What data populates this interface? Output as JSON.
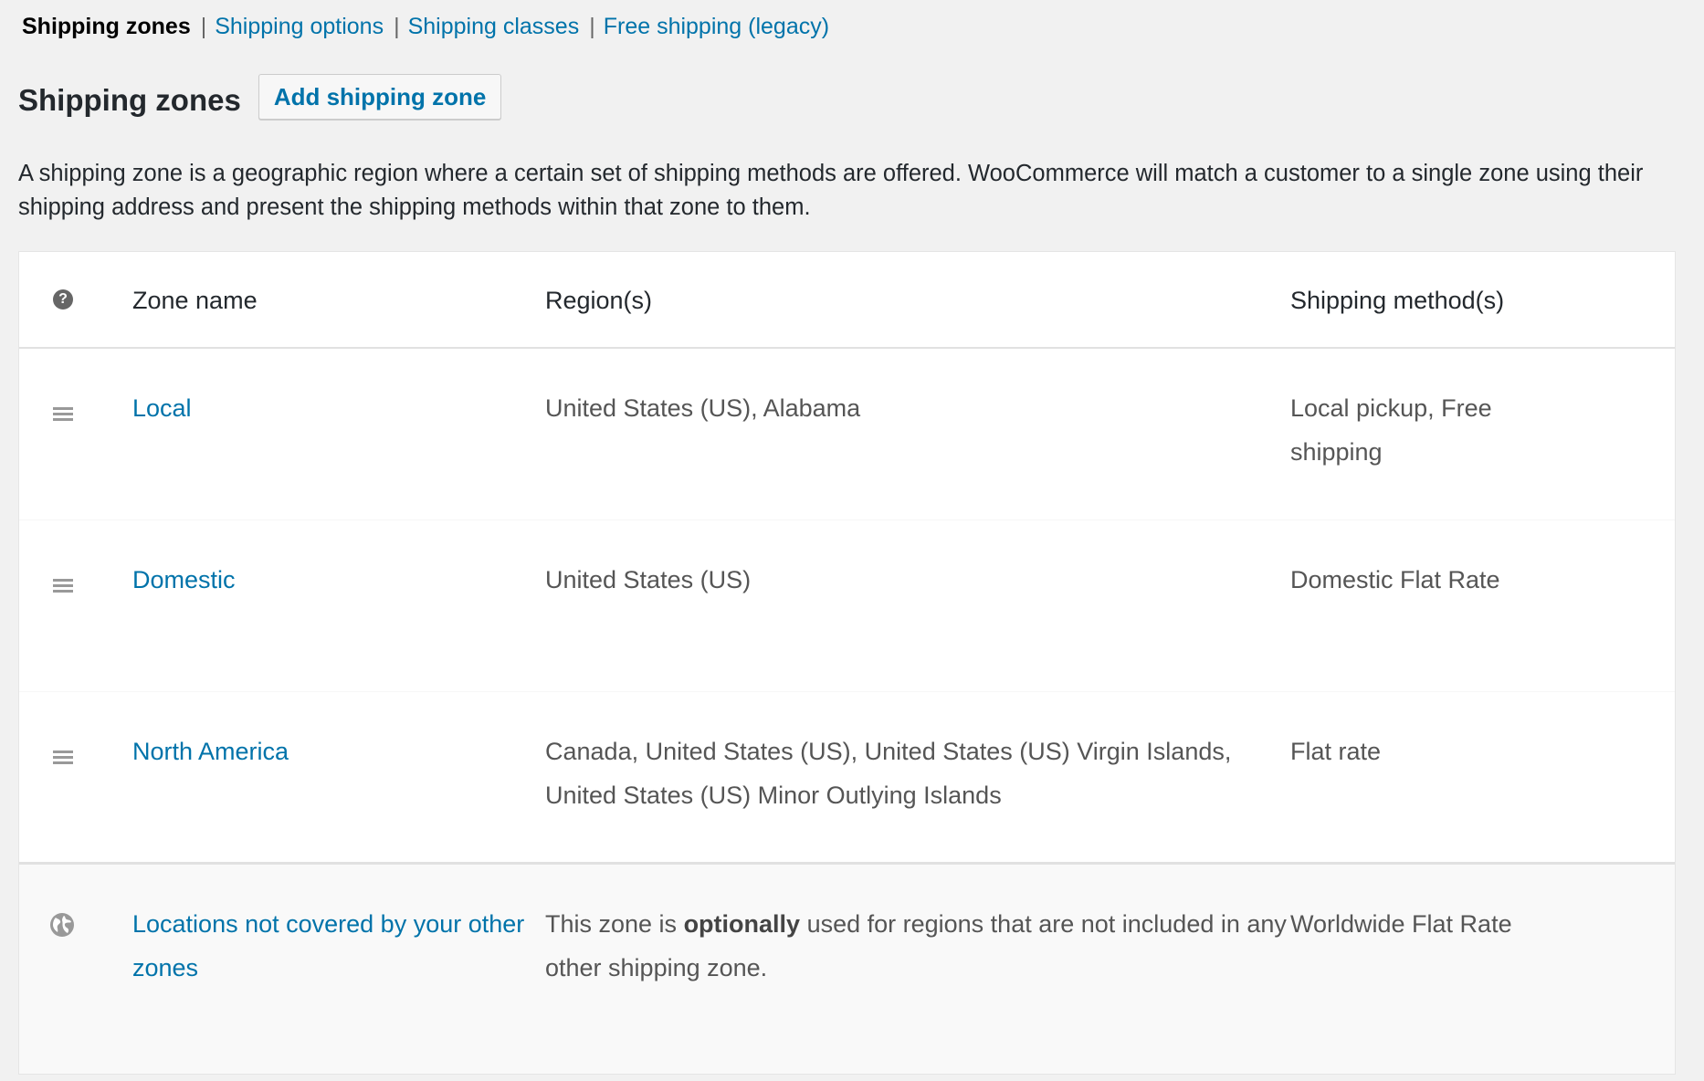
{
  "subnav": {
    "current": "Shipping zones",
    "links": [
      "Shipping options",
      "Shipping classes",
      "Free shipping (legacy)"
    ],
    "separator": "|"
  },
  "page": {
    "title": "Shipping zones",
    "add_button_label": "Add shipping zone",
    "description": "A shipping zone is a geographic region where a certain set of shipping methods are offered. WooCommerce will match a customer to a single zone using their shipping address and present the shipping methods within that zone to them."
  },
  "table": {
    "headers": {
      "icon": "help-icon",
      "zone_name": "Zone name",
      "regions": "Region(s)",
      "methods": "Shipping method(s)"
    },
    "rows": [
      {
        "icon": "drag-handle-icon",
        "zone_name": "Local",
        "regions": "United States (US), Alabama",
        "methods": "Local pickup, Free shipping"
      },
      {
        "icon": "drag-handle-icon",
        "zone_name": "Domestic",
        "regions": "United States (US)",
        "methods": "Domestic Flat Rate"
      },
      {
        "icon": "drag-handle-icon",
        "zone_name": "North America",
        "regions": "Canada, United States (US), United States (US) Virgin Islands, United States (US) Minor Outlying Islands",
        "methods": "Flat rate"
      }
    ],
    "rest_of_world": {
      "icon": "globe-icon",
      "zone_name": "Locations not covered by your other zones",
      "regions_pre": "This zone is ",
      "regions_bold": "optionally",
      "regions_post": " used for regions that are not included in any other shipping zone.",
      "methods": "Worldwide Flat Rate"
    }
  },
  "colors": {
    "link": "#0073aa",
    "background": "#f1f1f1",
    "text": "#23282d",
    "muted_text": "#555555",
    "icon": "#999999"
  }
}
